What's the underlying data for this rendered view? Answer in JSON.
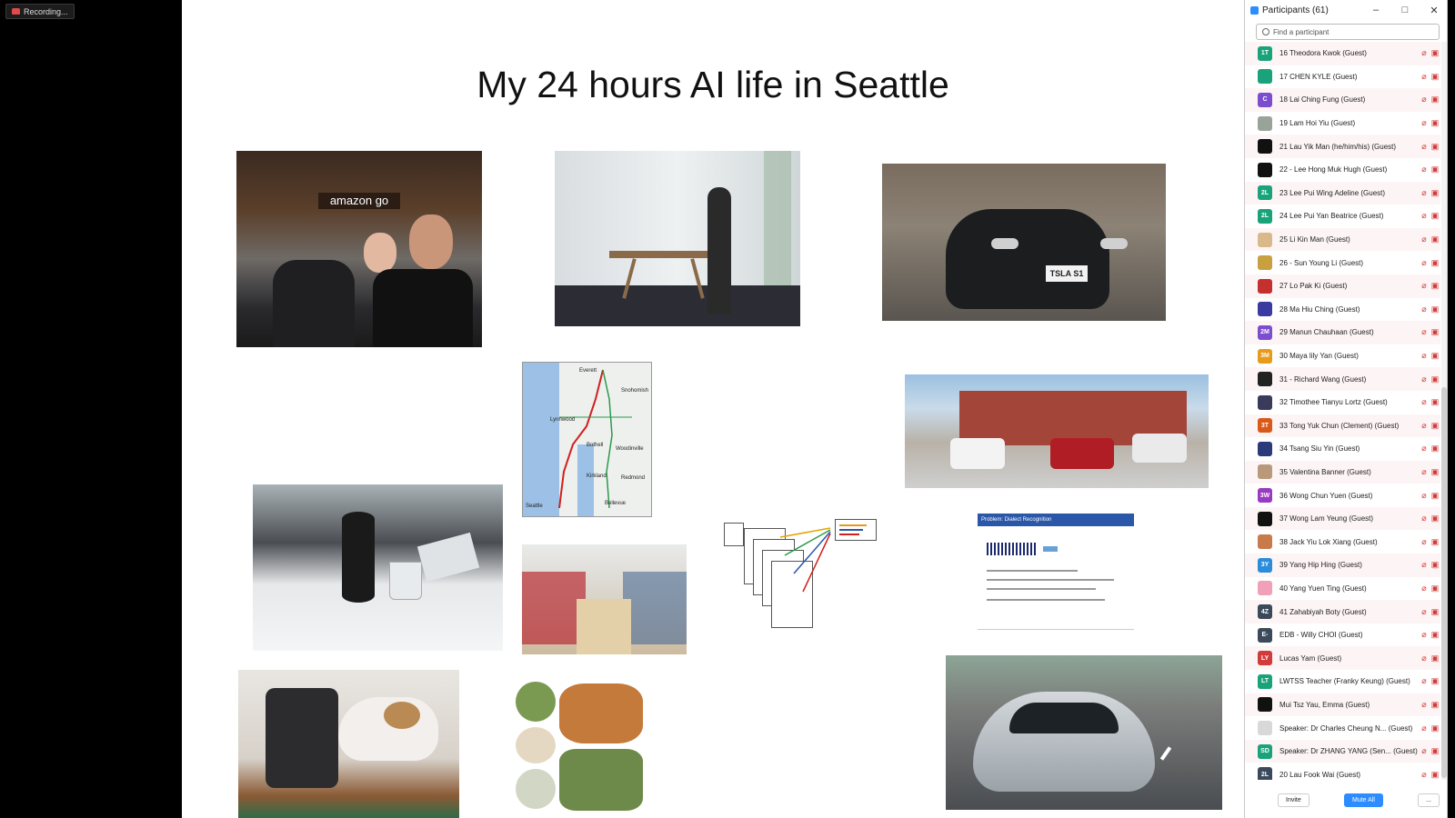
{
  "recording": {
    "label": "Recording..."
  },
  "slide": {
    "title": "My 24 hours AI life in Seattle"
  },
  "images": {
    "amazon_go_sign": "amazon go",
    "tesla_plate": "TSLA S1",
    "map_labels": [
      "Everett",
      "Snohomish",
      "Lynnwood",
      "Bothell",
      "Woodinville",
      "Kirkland",
      "Redmond",
      "Seattle",
      "Bellevue"
    ],
    "dialect_header": "Problem: Dialect Recognition"
  },
  "participants": {
    "title": "Participants (61)",
    "search_placeholder": "Find a participant",
    "items": [
      {
        "name": "16 Theodora Kwok (Guest)",
        "initials": "1T",
        "color": "#1aa37a"
      },
      {
        "name": "17 CHEN KYLE (Guest)",
        "initials": "",
        "color": "#1aa37a"
      },
      {
        "name": "18 Lai Ching Fung (Guest)",
        "initials": "C",
        "color": "#7c4dcf"
      },
      {
        "name": "19 Lam Hoi Yiu (Guest)",
        "initials": "",
        "color": "#9aa39a"
      },
      {
        "name": "21 Lau Yik Man (he/him/his) (Guest)",
        "initials": "",
        "color": "#111111"
      },
      {
        "name": "22 - Lee Hong Muk Hugh (Guest)",
        "initials": "",
        "color": "#111111"
      },
      {
        "name": "23 Lee Pui Wing Adeline (Guest)",
        "initials": "2L",
        "color": "#1aa37a"
      },
      {
        "name": "24 Lee Pui Yan Beatrice (Guest)",
        "initials": "2L",
        "color": "#1aa37a"
      },
      {
        "name": "25 Li Kin Man (Guest)",
        "initials": "",
        "color": "#d9b98a"
      },
      {
        "name": "26 - Sun Young Li (Guest)",
        "initials": "",
        "color": "#c8a040"
      },
      {
        "name": "27 Lo Pak Ki (Guest)",
        "initials": "",
        "color": "#c43030"
      },
      {
        "name": "28 Ma Hiu Ching (Guest)",
        "initials": "",
        "color": "#3a3aa0"
      },
      {
        "name": "29 Manun Chauhaan (Guest)",
        "initials": "2M",
        "color": "#7c4dcf"
      },
      {
        "name": "30 Maya lily Yan (Guest)",
        "initials": "3M",
        "color": "#e89a1a"
      },
      {
        "name": "31 - Richard Wang (Guest)",
        "initials": "",
        "color": "#222222"
      },
      {
        "name": "32 Timothee Tianyu Lortz (Guest)",
        "initials": "",
        "color": "#3a3a5a"
      },
      {
        "name": "33 Tong Yuk Chun (Clement) (Guest)",
        "initials": "3T",
        "color": "#d9591a"
      },
      {
        "name": "34 Tsang Siu Yin (Guest)",
        "initials": "",
        "color": "#2a3a7a"
      },
      {
        "name": "35 Valentina Banner (Guest)",
        "initials": "",
        "color": "#b89a7a"
      },
      {
        "name": "36 Wong Chun Yuen (Guest)",
        "initials": "3W",
        "color": "#9a3ac0"
      },
      {
        "name": "37 Wong Lam Yeung (Guest)",
        "initials": "",
        "color": "#111111"
      },
      {
        "name": "38 Jack Yiu Lok Xiang (Guest)",
        "initials": "",
        "color": "#c87a4a"
      },
      {
        "name": "39 Yang Hip Hing (Guest)",
        "initials": "3Y",
        "color": "#2d8cd9"
      },
      {
        "name": "40 Yang Yuen Ting (Guest)",
        "initials": "",
        "color": "#f0a0b8"
      },
      {
        "name": "41 Zahabiyah Boty (Guest)",
        "initials": "4Z",
        "color": "#3a4a5a"
      },
      {
        "name": "EDB - Willy CHOI (Guest)",
        "initials": "E-",
        "color": "#3a4a5a"
      },
      {
        "name": "Lucas Yam (Guest)",
        "initials": "LY",
        "color": "#d23b3b"
      },
      {
        "name": "LWTSS Teacher (Franky Keung) (Guest)",
        "initials": "LT",
        "color": "#1aa37a"
      },
      {
        "name": "Mui Tsz Yau, Emma (Guest)",
        "initials": "",
        "color": "#111111"
      },
      {
        "name": "Speaker: Dr Charles Cheung N...  (Guest)",
        "initials": "",
        "color": "#d8d8d8"
      },
      {
        "name": "Speaker: Dr ZHANG YANG (Sen...  (Guest)",
        "initials": "SD",
        "color": "#1aa37a"
      },
      {
        "name": "20 Lau Fook Wai (Guest)",
        "initials": "2L",
        "color": "#3a4a5a"
      }
    ],
    "footer": {
      "invite": "Invite",
      "mute_all": "Mute All",
      "more": "..."
    }
  }
}
